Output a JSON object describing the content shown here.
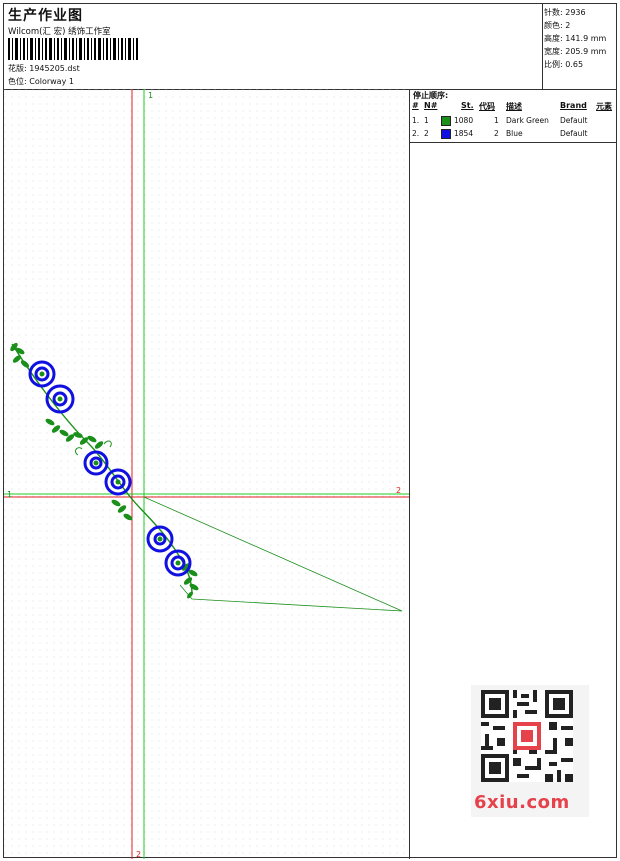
{
  "header": {
    "title": "生产作业图",
    "subtitle": "Wilcom(汇 宏) 绣饰工作室",
    "design_label": "花版:",
    "design_value": "1945205.dst",
    "colorway_label": "色位:",
    "colorway_value": "Colorway 1"
  },
  "stats": {
    "stitches_label": "针数:",
    "stitches": "2936",
    "colors_label": "颜色:",
    "colors": "2",
    "height_label": "高度:",
    "height": "141.9 mm",
    "width_label": "宽度:",
    "width": "205.9 mm",
    "scale_label": "比例:",
    "scale": "0.65"
  },
  "stop_sequence": {
    "title": "停止顺序:",
    "columns": {
      "num": "#",
      "no": "N#",
      "st": "St.",
      "code": "代码",
      "desc": "描述",
      "brand": "Brand",
      "elem": "元素"
    },
    "rows": [
      {
        "num": "1.",
        "no": "1",
        "color": "#1a8f1a",
        "st": "1080",
        "code": "1",
        "desc": "Dark Green",
        "brand": "Default"
      },
      {
        "num": "2.",
        "no": "2",
        "color": "#1010e0",
        "st": "1854",
        "code": "2",
        "desc": "Blue",
        "brand": "Default"
      }
    ]
  },
  "axes": {
    "v_green": "1",
    "h_green": "1",
    "h_red": "2",
    "v_red": "2"
  },
  "colors": {
    "thread_green": "#1a8f1a",
    "thread_blue": "#1010e0",
    "axis_red": "#e02020",
    "axis_green": "#22cc22"
  },
  "watermark": {
    "text": "6xiu.com"
  }
}
